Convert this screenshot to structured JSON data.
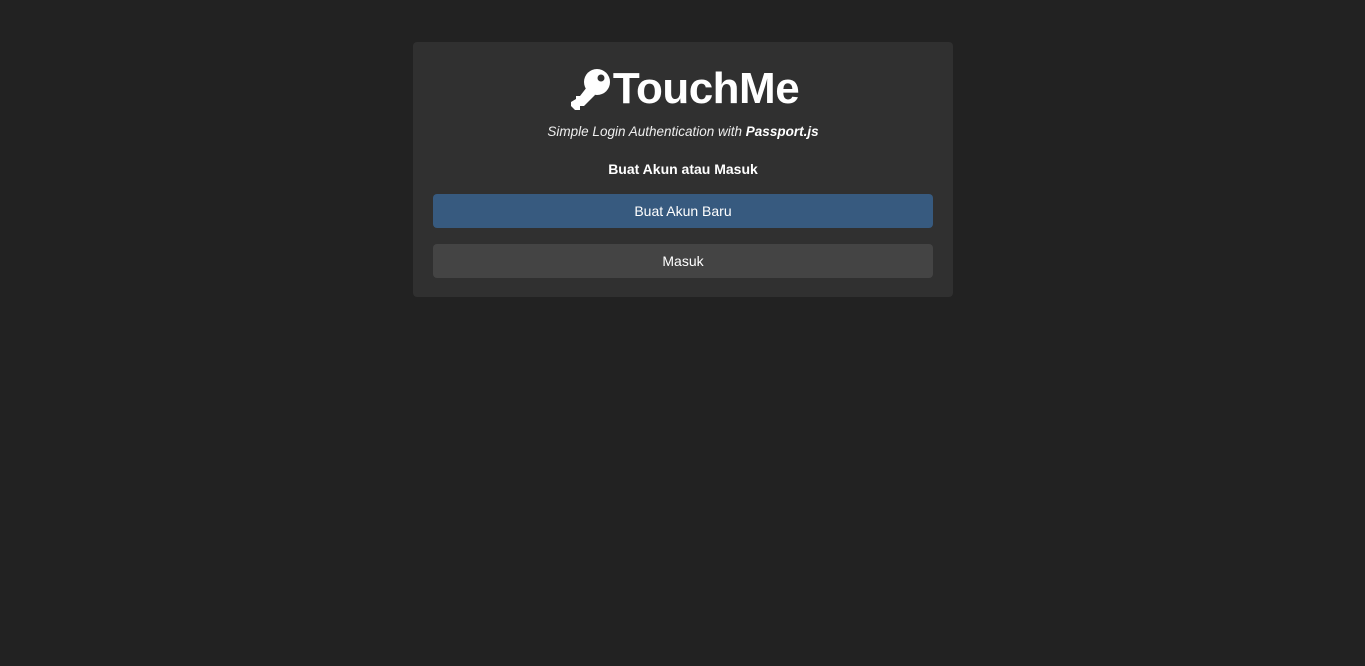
{
  "brand": {
    "icon": "key-icon",
    "title": "TouchMe"
  },
  "tagline": {
    "prefix": "Simple Login Authentication with ",
    "emphasis": "Passport.js"
  },
  "prompt": "Buat Akun atau Masuk",
  "buttons": {
    "register_label": "Buat Akun Baru",
    "login_label": "Masuk"
  },
  "colors": {
    "background": "#222222",
    "card": "#303030",
    "primary": "#375a7f",
    "secondary": "#444444"
  }
}
